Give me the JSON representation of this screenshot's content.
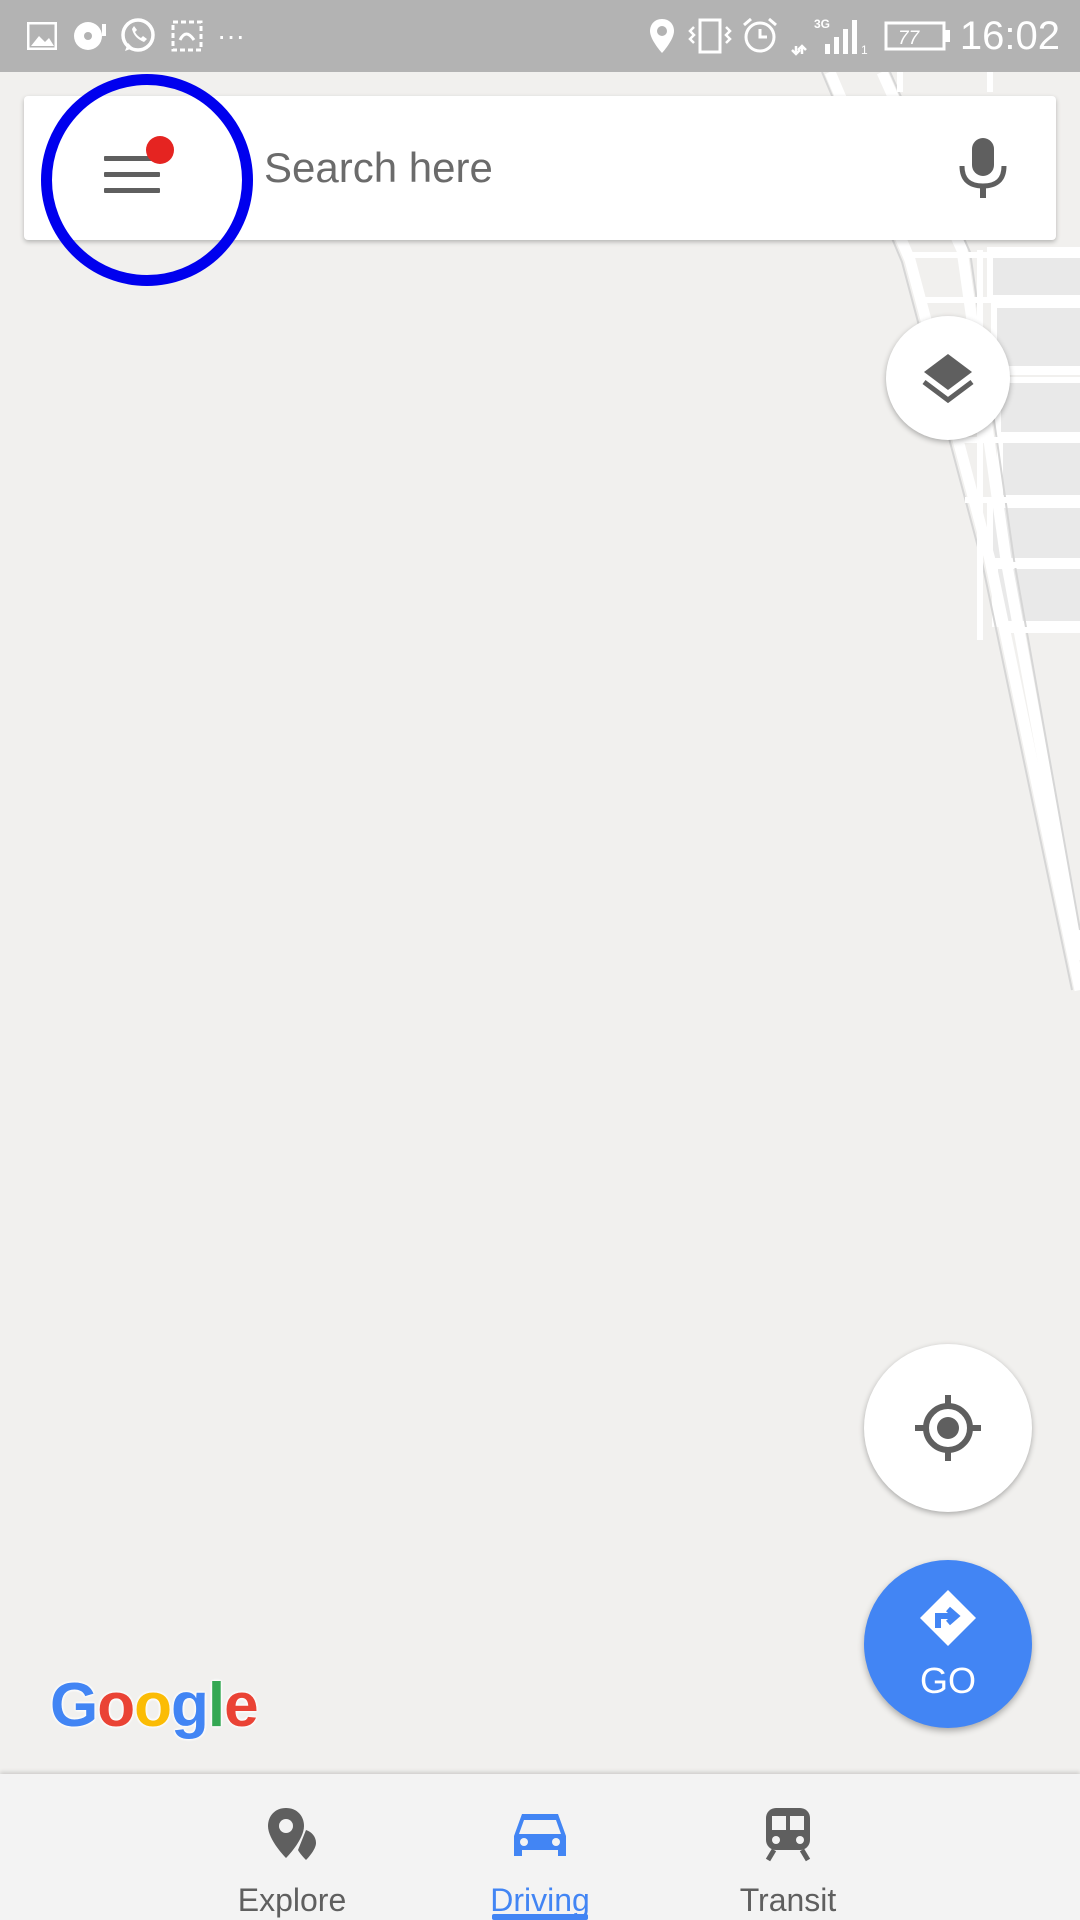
{
  "status_bar": {
    "time": "16:02",
    "battery": "77",
    "network": "3G",
    "left_icons": [
      "image-icon",
      "music-icon",
      "whatsapp-icon",
      "screenshot-icon",
      "more-icon"
    ],
    "right_icons": [
      "location-icon",
      "vibrate-icon",
      "alarm-icon",
      "network-3g-icon",
      "signal-icon",
      "battery-icon"
    ]
  },
  "search": {
    "placeholder": "Search here",
    "menu_icon": "hamburger-menu-icon",
    "mic_icon": "microphone-icon"
  },
  "map_controls": {
    "layers_icon": "layers-icon",
    "locate_icon": "my-location-icon",
    "go_label": "GO"
  },
  "brand": {
    "logo": "Google",
    "logo_colors": [
      "#4285f4",
      "#ea4335",
      "#fbbc05",
      "#4285f4",
      "#34a853",
      "#ea4335"
    ]
  },
  "bottom_nav": {
    "items": [
      {
        "label": "Explore",
        "icon": "explore-icon",
        "active": false
      },
      {
        "label": "Driving",
        "icon": "car-icon",
        "active": true
      },
      {
        "label": "Transit",
        "icon": "transit-icon",
        "active": false
      }
    ]
  },
  "colors": {
    "accent": "#4285f4",
    "notification_dot": "#e52421",
    "highlight_ring": "#0000ee",
    "map_background": "#f1f0ee"
  }
}
